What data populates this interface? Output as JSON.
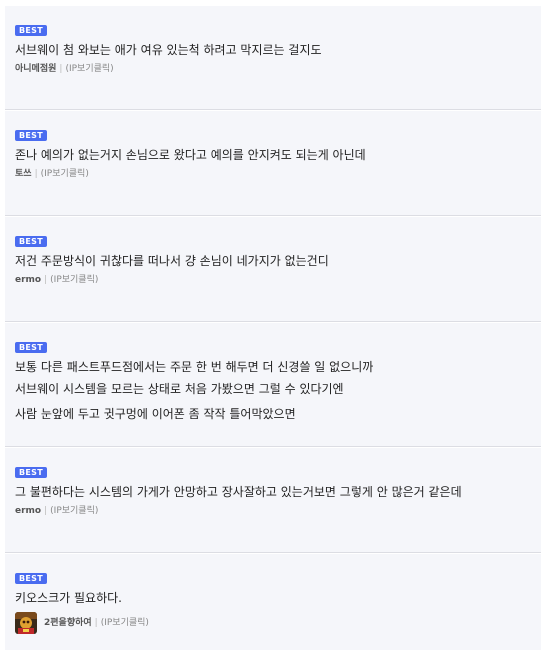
{
  "comments": [
    {
      "badge": "BEST",
      "lines": [
        "서브웨이 첨 와보는 애가 여유 있는척 하려고 막지르는 걸지도"
      ],
      "author": "아니메점원",
      "separator": "|",
      "ip_label": "(IP보기클릭)"
    },
    {
      "badge": "BEST",
      "lines": [
        "존나 예의가 없는거지 손님으로 왔다고 예의를 안지켜도 되는게 아닌데"
      ],
      "author": "토쓰",
      "separator": "|",
      "ip_label": "(IP보기클릭)"
    },
    {
      "badge": "BEST",
      "lines": [
        "저건 주문방식이 귀찮다를 떠나서 걍 손님이 네가지가 없는건디"
      ],
      "author": "ermo",
      "separator": "|",
      "ip_label": "(IP보기클릭)"
    },
    {
      "badge": "BEST",
      "lines": [
        "보통 다른 패스트푸드점에서는 주문 한 번 해두면 더 신경쓸 일 없으니까",
        "서브웨이 시스템을 모르는 상태로 처음 가봤으면 그럴 수 있다기엔",
        "사람 눈앞에 두고 귓구멍에 이어폰 좀 작작 틀어막았으면"
      ],
      "author": "",
      "separator": "",
      "ip_label": ""
    },
    {
      "badge": "BEST",
      "lines": [
        "그 불편하다는 시스템의 가게가 안망하고 장사잘하고 있는거보면 그렇게 안 많은거 같은데"
      ],
      "author": "ermo",
      "separator": "|",
      "ip_label": "(IP보기클릭)"
    },
    {
      "badge": "BEST",
      "lines": [
        "키오스크가 필요하다."
      ],
      "author": "2편을향하여",
      "separator": "|",
      "ip_label": "(IP보기클릭)",
      "has_avatar": true
    }
  ]
}
